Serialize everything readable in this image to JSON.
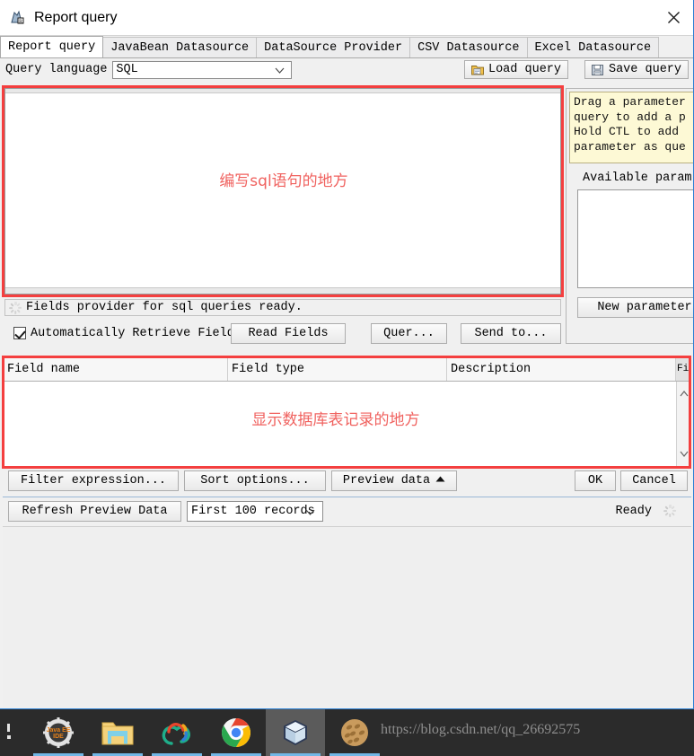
{
  "window": {
    "title": "Report query",
    "title_icon": "report-query-icon",
    "close_icon": "close-icon"
  },
  "tabs": [
    {
      "label": "Report query",
      "active": true
    },
    {
      "label": "JavaBean Datasource",
      "active": false
    },
    {
      "label": "DataSource Provider",
      "active": false
    },
    {
      "label": "CSV Datasource",
      "active": false
    },
    {
      "label": "Excel Datasource",
      "active": false
    }
  ],
  "query_language": {
    "label": "Query language",
    "value": "SQL",
    "chevron_icon": "chevron-down-icon"
  },
  "toolbar": {
    "load_query": "Load query",
    "load_query_icon": "open-folder-icon",
    "save_query": "Save query",
    "save_query_icon": "save-disk-icon"
  },
  "sql_editor": {
    "value": "",
    "annotation": "编写sql语句的地方"
  },
  "parameters": {
    "tooltip_lines": [
      "Drag a parameter",
      "query to add a p",
      "Hold CTL to add",
      "parameter as que"
    ],
    "available_label": "Available param",
    "new_parameter_button": "New parameter"
  },
  "status": {
    "message": "Fields provider for sql queries ready.",
    "spinner_icon": "loading-spinner-icon"
  },
  "fields_row": {
    "auto_retrieve_label": "Automatically Retrieve Fields",
    "auto_retrieve_checked": true,
    "read_fields": "Read Fields",
    "query_button": "Quer...",
    "send_to_button": "Send to..."
  },
  "fields_table": {
    "columns": [
      "Field name",
      "Field type",
      "Description",
      "Fi"
    ],
    "rows": [],
    "annotation": "显示数据库表记录的地方",
    "scroll_up_icon": "chevron-up-icon",
    "scroll_down_icon": "chevron-down-icon"
  },
  "actions": {
    "filter_expression": "Filter expression...",
    "sort_options": "Sort options...",
    "preview_data": "Preview data",
    "preview_data_icon": "triangle-up-icon",
    "ok": "OK",
    "cancel": "Cancel"
  },
  "preview_bar": {
    "refresh": "Refresh Preview Data",
    "records_value": "First 100 records",
    "records_chevron_icon": "chevron-down-icon",
    "ready_label": "Ready",
    "ready_spinner_icon": "loading-spinner-icon"
  },
  "taskbar": {
    "items": [
      {
        "name": "javaee-ide-icon",
        "active": false
      },
      {
        "name": "file-explorer-icon",
        "active": false
      },
      {
        "name": "navicat-icon",
        "active": false
      },
      {
        "name": "chrome-icon",
        "active": false
      },
      {
        "name": "ireport-cube-icon",
        "active": true
      },
      {
        "name": "cookie-app-icon",
        "active": false
      }
    ],
    "watermark": "https://blog.csdn.net/qq_26692575"
  },
  "colors": {
    "annotation_red": "#f0625f",
    "annotation_box": "#f43f3f",
    "window_border": "#2a7fd4",
    "tooltip_bg": "#fdf9d5",
    "taskbar_bg": "#2b2b2b",
    "taskbar_active": "#5b5b5b",
    "taskbar_underline": "#71b7e6"
  }
}
